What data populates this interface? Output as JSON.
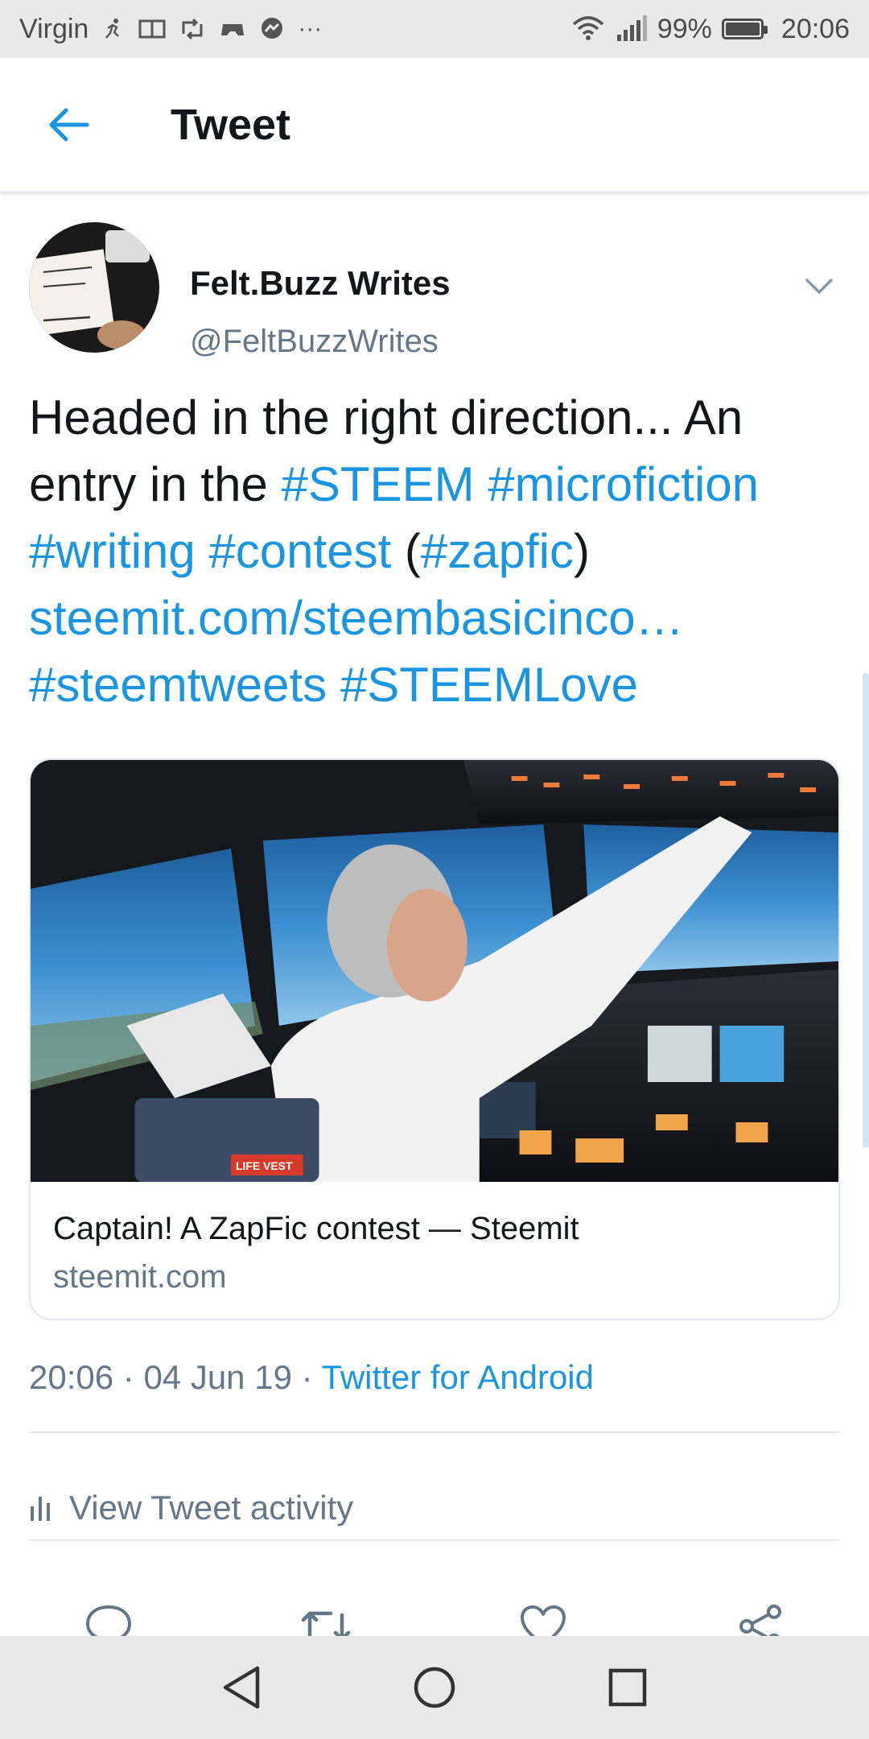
{
  "status_bar": {
    "carrier": "Virgin",
    "battery_percent": "99%",
    "time": "20:06",
    "overflow": "···",
    "icons": [
      "running-icon",
      "book-icon",
      "retweet-icon",
      "game-icon",
      "messenger-icon",
      "wifi-icon",
      "signal-icon",
      "battery-icon"
    ]
  },
  "header": {
    "title": "Tweet",
    "back_icon": "back-arrow-icon"
  },
  "tweet": {
    "author_name": "Felt.Buzz Writes",
    "author_handle": "@FeltBuzzWrites",
    "text": {
      "line1": "Headed in the right direction... An",
      "line2_prefix": "entry in the ",
      "tag_steem": "#STEEM",
      "tag_microfiction": "#microfiction",
      "tag_writing": "#writing",
      "tag_contest": "#contest",
      "paren_open": "(",
      "tag_zapfic": "#zapfic",
      "paren_close": ")",
      "link": "steemit.com/steembasicinco…",
      "tag_steemtweets": "#steemtweets",
      "tag_steemlove": "#STEEMLove"
    },
    "card": {
      "title": "Captain! A ZapFic contest — Steemit",
      "domain": "steemit.com",
      "image_label": "LIFE VEST"
    },
    "meta": {
      "time": "20:06",
      "separator": " · ",
      "date": "04 Jun 19",
      "source": "Twitter for Android"
    },
    "activity_label": "View Tweet activity"
  },
  "actions": [
    "reply-icon",
    "retweet-icon",
    "like-icon",
    "share-icon"
  ],
  "colors": {
    "accent": "#1b95e0",
    "text": "#14171a",
    "secondary": "#657786",
    "border": "#e1e8ed",
    "system_bar": "#e9e9ea"
  }
}
